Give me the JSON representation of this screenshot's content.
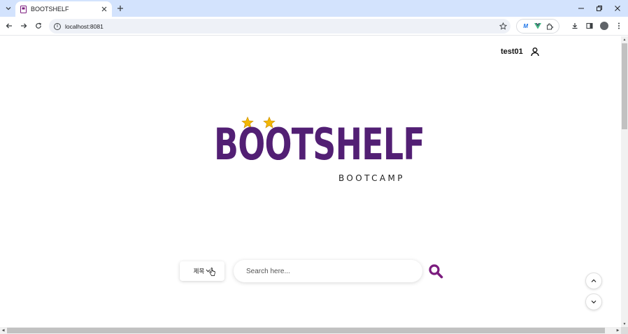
{
  "browser": {
    "tab_title": "BOOTSHELF",
    "url": "localhost:8081",
    "icons": {
      "tab_list": "chevron-down-icon",
      "tab_close": "close-icon",
      "new_tab": "plus-icon",
      "minimize": "minimize-icon",
      "restore": "restore-icon",
      "close_window": "close-icon",
      "back": "arrow-left-icon",
      "forward": "arrow-right-icon",
      "reload": "reload-icon",
      "site_info": "info-icon",
      "bookmark": "star-icon",
      "downloads": "download-icon",
      "side_panel": "side-panel-icon",
      "menu": "more-vertical-icon"
    },
    "colors": {
      "tab_strip": "#d3e3fd",
      "omnibox": "#eef1f7"
    }
  },
  "header": {
    "username": "test01",
    "user_icon": "user-icon"
  },
  "logo": {
    "title": "BOOTSHELF",
    "subtitle": "BOOTCAMP",
    "color": "#521f74",
    "star_color": "#f2b705"
  },
  "search": {
    "category": "제목",
    "placeholder": "Search here...",
    "button_icon": "search-icon",
    "button_color": "#7b1c7e"
  },
  "scroll_controls": {
    "up_icon": "chevron-up-icon",
    "down_icon": "chevron-down-icon"
  }
}
